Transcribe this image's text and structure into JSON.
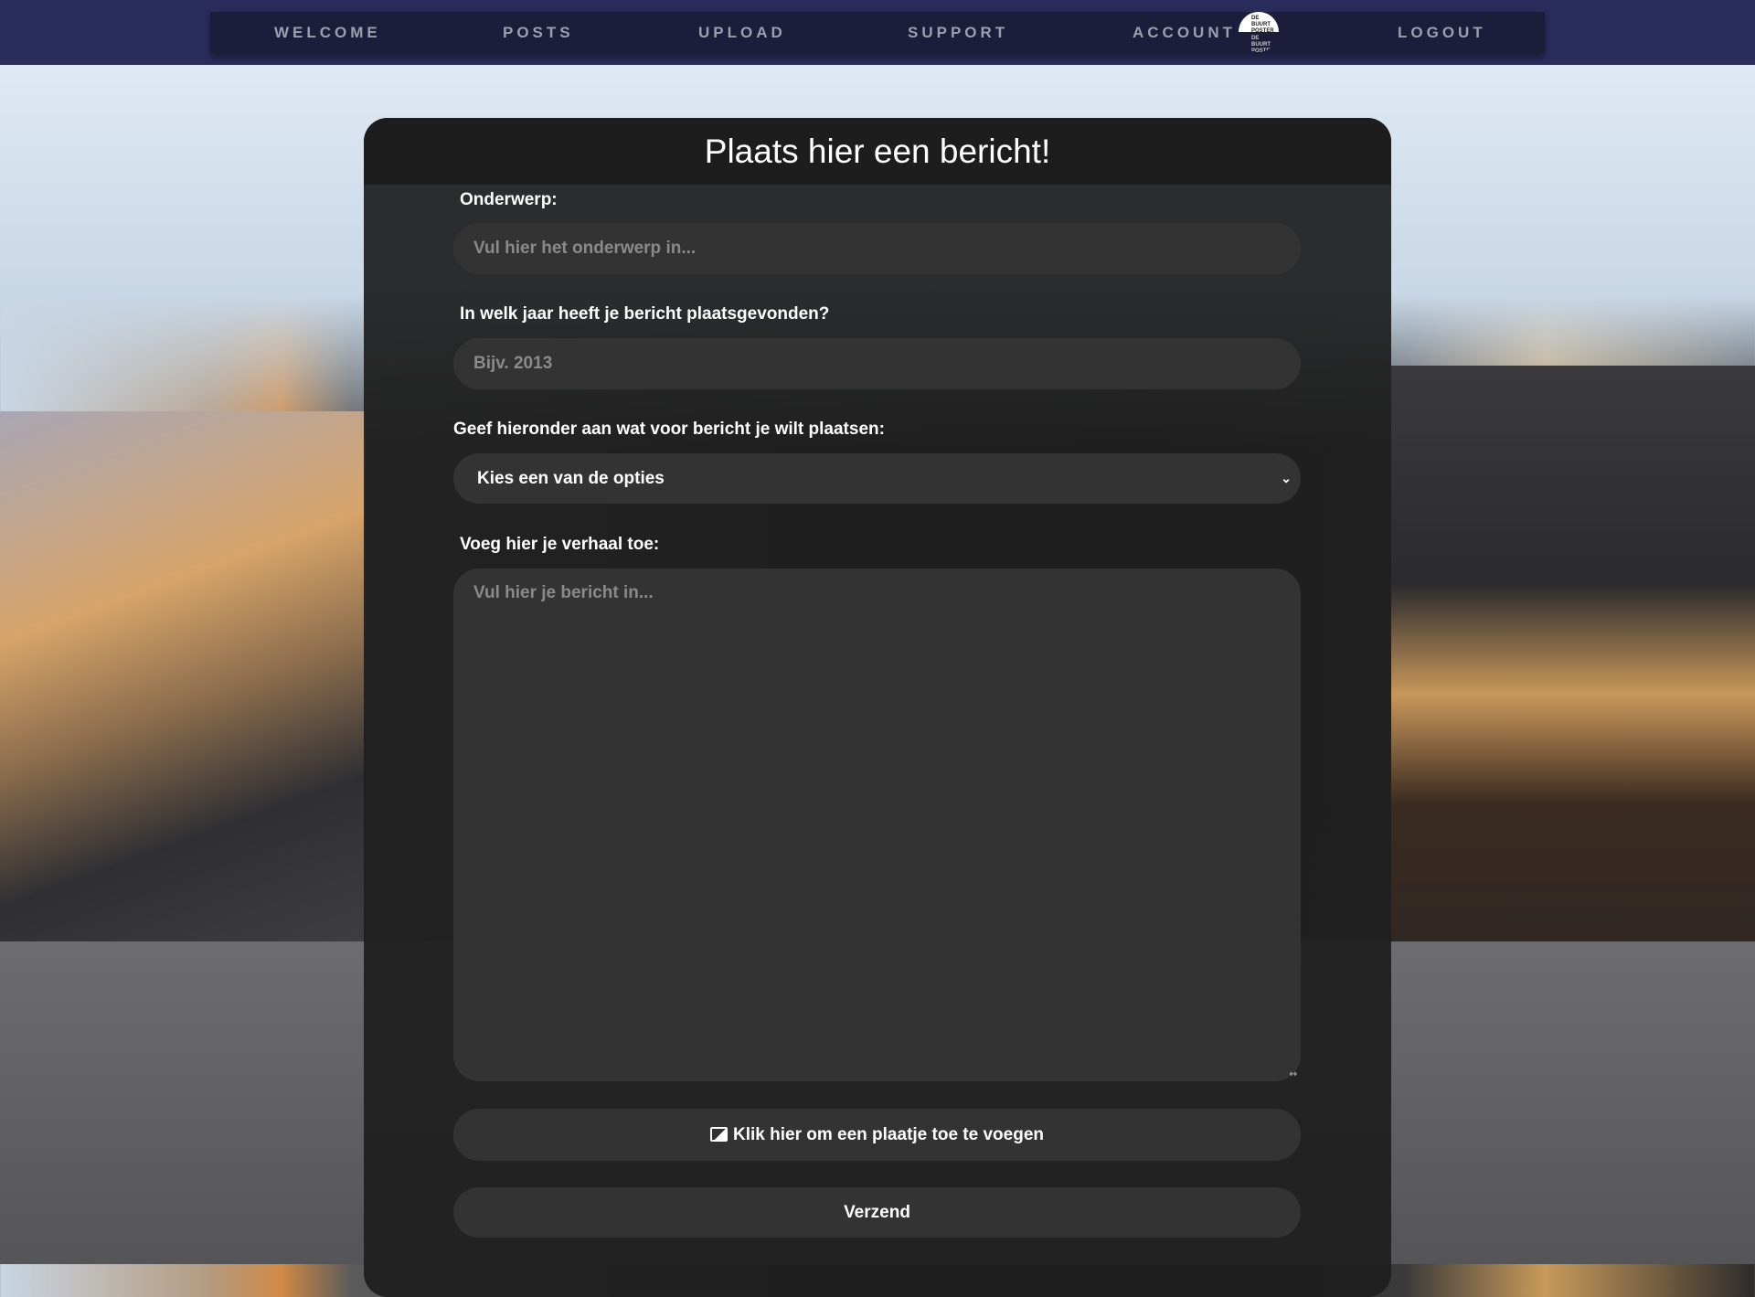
{
  "nav": {
    "items": [
      "WELCOME",
      "POSTS",
      "UPLOAD",
      "SUPPORT",
      "ACCOUNT",
      "LOGOUT"
    ],
    "logo_text": "DE BUURT POSTER"
  },
  "form": {
    "title": "Plaats hier een bericht!",
    "subject_label": "Onderwerp:",
    "subject_placeholder": "Vul hier het onderwerp in...",
    "year_label": "In welk jaar heeft je bericht plaatsgevonden?",
    "year_placeholder": "Bijv. 2013",
    "type_label": "Geef hieronder aan wat voor bericht je wilt plaatsen:",
    "type_selected": "Kies een van de opties",
    "story_label": "Voeg hier je verhaal toe:",
    "story_placeholder": "Vul hier je bericht in...",
    "image_button": "Klik hier om een plaatje toe te voegen",
    "submit_button": "Verzend"
  }
}
